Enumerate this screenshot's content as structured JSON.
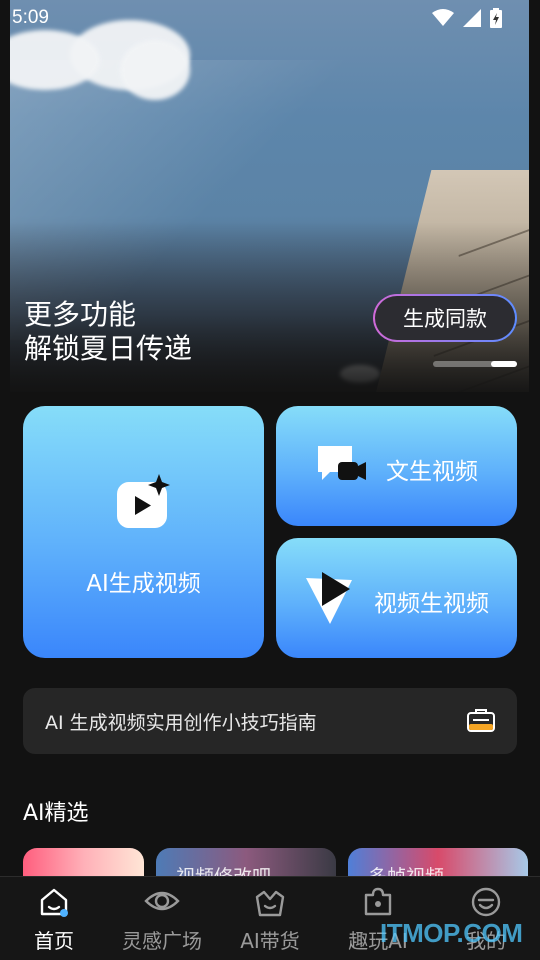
{
  "status_bar": {
    "time": "5:09"
  },
  "hero": {
    "title_line1": "更多功能",
    "title_line2": "解锁夏日传递",
    "button_label": "生成同款"
  },
  "features": {
    "ai_video": "AI生成视频",
    "text_to_video": "文生视频",
    "video_to_video": "视频生视频"
  },
  "guide": {
    "text": "AI 生成视频实用创作小技巧指南"
  },
  "section": {
    "title": "AI精选"
  },
  "thumbs": [
    "视频修改吧",
    "多帧视频"
  ],
  "nav": {
    "items": [
      {
        "label": "首页",
        "icon": "home-icon",
        "active": true
      },
      {
        "label": "灵感广场",
        "icon": "eye-icon"
      },
      {
        "label": "AI带货",
        "icon": "shopping-bag-icon"
      },
      {
        "label": "趣玩AI",
        "icon": "puzzle-icon"
      },
      {
        "label": "我的",
        "icon": "smile-icon"
      }
    ]
  },
  "watermark": "ITMOP.COM",
  "colors": {
    "card_top": "#86ddf9",
    "card_bottom": "#3a86fb",
    "background": "#121212",
    "nav_active": "#ffffff"
  }
}
